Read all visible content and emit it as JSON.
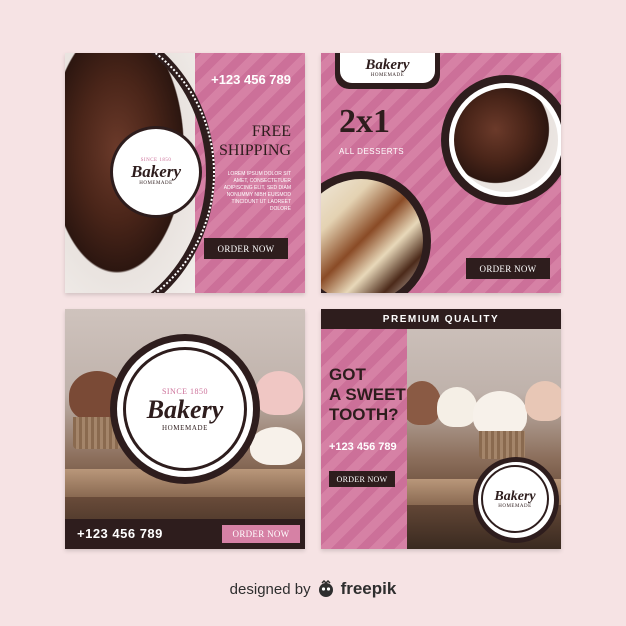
{
  "brand": {
    "name": "Bakery",
    "since": "SINCE 1850",
    "tagline": "HOMEMADE"
  },
  "card1": {
    "phone": "+123 456 789",
    "headline_1": "FREE",
    "headline_2": "SHIPPING",
    "body": "LOREM IPSUM DOLOR SIT AMET, CONSECTETUER ADIPISCING ELIT, SED DIAM NONUMMY NIBH EUISMOD TINCIDUNT UT LAOREET DOLORE",
    "cta": "ORDER NOW"
  },
  "card2": {
    "offer": "2x1",
    "offer_sub": "ALL DESSERTS",
    "cta": "ORDER NOW"
  },
  "card3": {
    "phone": "+123 456 789",
    "cta": "ORDER NOW"
  },
  "card4": {
    "banner": "PREMIUM QUALITY",
    "headline_1": "GOT",
    "headline_2": "A SWEET",
    "headline_3": "TOOTH?",
    "phone": "+123 456 789",
    "cta": "ORDER NOW"
  },
  "footer": {
    "prefix": "designed by",
    "logo_text": "freepik"
  },
  "colors": {
    "pink": "#d681a5",
    "dark": "#2e1d1d",
    "light_pink": "#f6e3e4",
    "white": "#ffffff"
  }
}
